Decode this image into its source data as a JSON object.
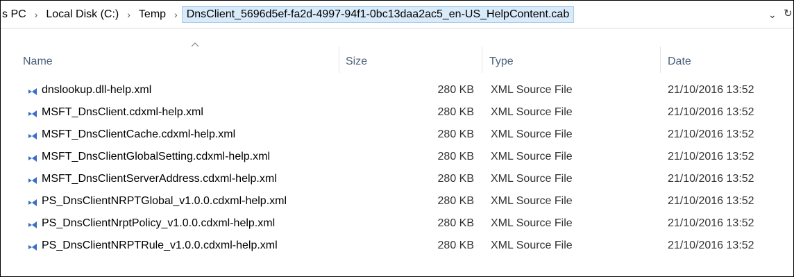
{
  "breadcrumb": {
    "items": [
      "s PC",
      "Local Disk (C:)",
      "Temp"
    ],
    "current": "DnsClient_5696d5ef-fa2d-4997-94f1-0bc13daa2ac5_en-US_HelpContent.cab",
    "separator": "›"
  },
  "address_dropdown": "⌄",
  "refresh": "↻",
  "columns": {
    "name": "Name",
    "size": "Size",
    "type": "Type",
    "date": "Date"
  },
  "files": [
    {
      "name": "dnslookup.dll-help.xml",
      "size": "280 KB",
      "type": "XML Source File",
      "date": "21/10/2016 13:52"
    },
    {
      "name": "MSFT_DnsClient.cdxml-help.xml",
      "size": "280 KB",
      "type": "XML Source File",
      "date": "21/10/2016 13:52"
    },
    {
      "name": "MSFT_DnsClientCache.cdxml-help.xml",
      "size": "280 KB",
      "type": "XML Source File",
      "date": "21/10/2016 13:52"
    },
    {
      "name": "MSFT_DnsClientGlobalSetting.cdxml-help.xml",
      "size": "280 KB",
      "type": "XML Source File",
      "date": "21/10/2016 13:52"
    },
    {
      "name": "MSFT_DnsClientServerAddress.cdxml-help.xml",
      "size": "280 KB",
      "type": "XML Source File",
      "date": "21/10/2016 13:52"
    },
    {
      "name": "PS_DnsClientNRPTGlobal_v1.0.0.cdxml-help.xml",
      "size": "280 KB",
      "type": "XML Source File",
      "date": "21/10/2016 13:52"
    },
    {
      "name": "PS_DnsClientNrptPolicy_v1.0.0.cdxml-help.xml",
      "size": "280 KB",
      "type": "XML Source File",
      "date": "21/10/2016 13:52"
    },
    {
      "name": "PS_DnsClientNRPTRule_v1.0.0.cdxml-help.xml",
      "size": "280 KB",
      "type": "XML Source File",
      "date": "21/10/2016 13:52"
    }
  ],
  "icon": "xml-file-icon",
  "accent_color": "#d9eaf9",
  "header_text_color": "#4c607a"
}
